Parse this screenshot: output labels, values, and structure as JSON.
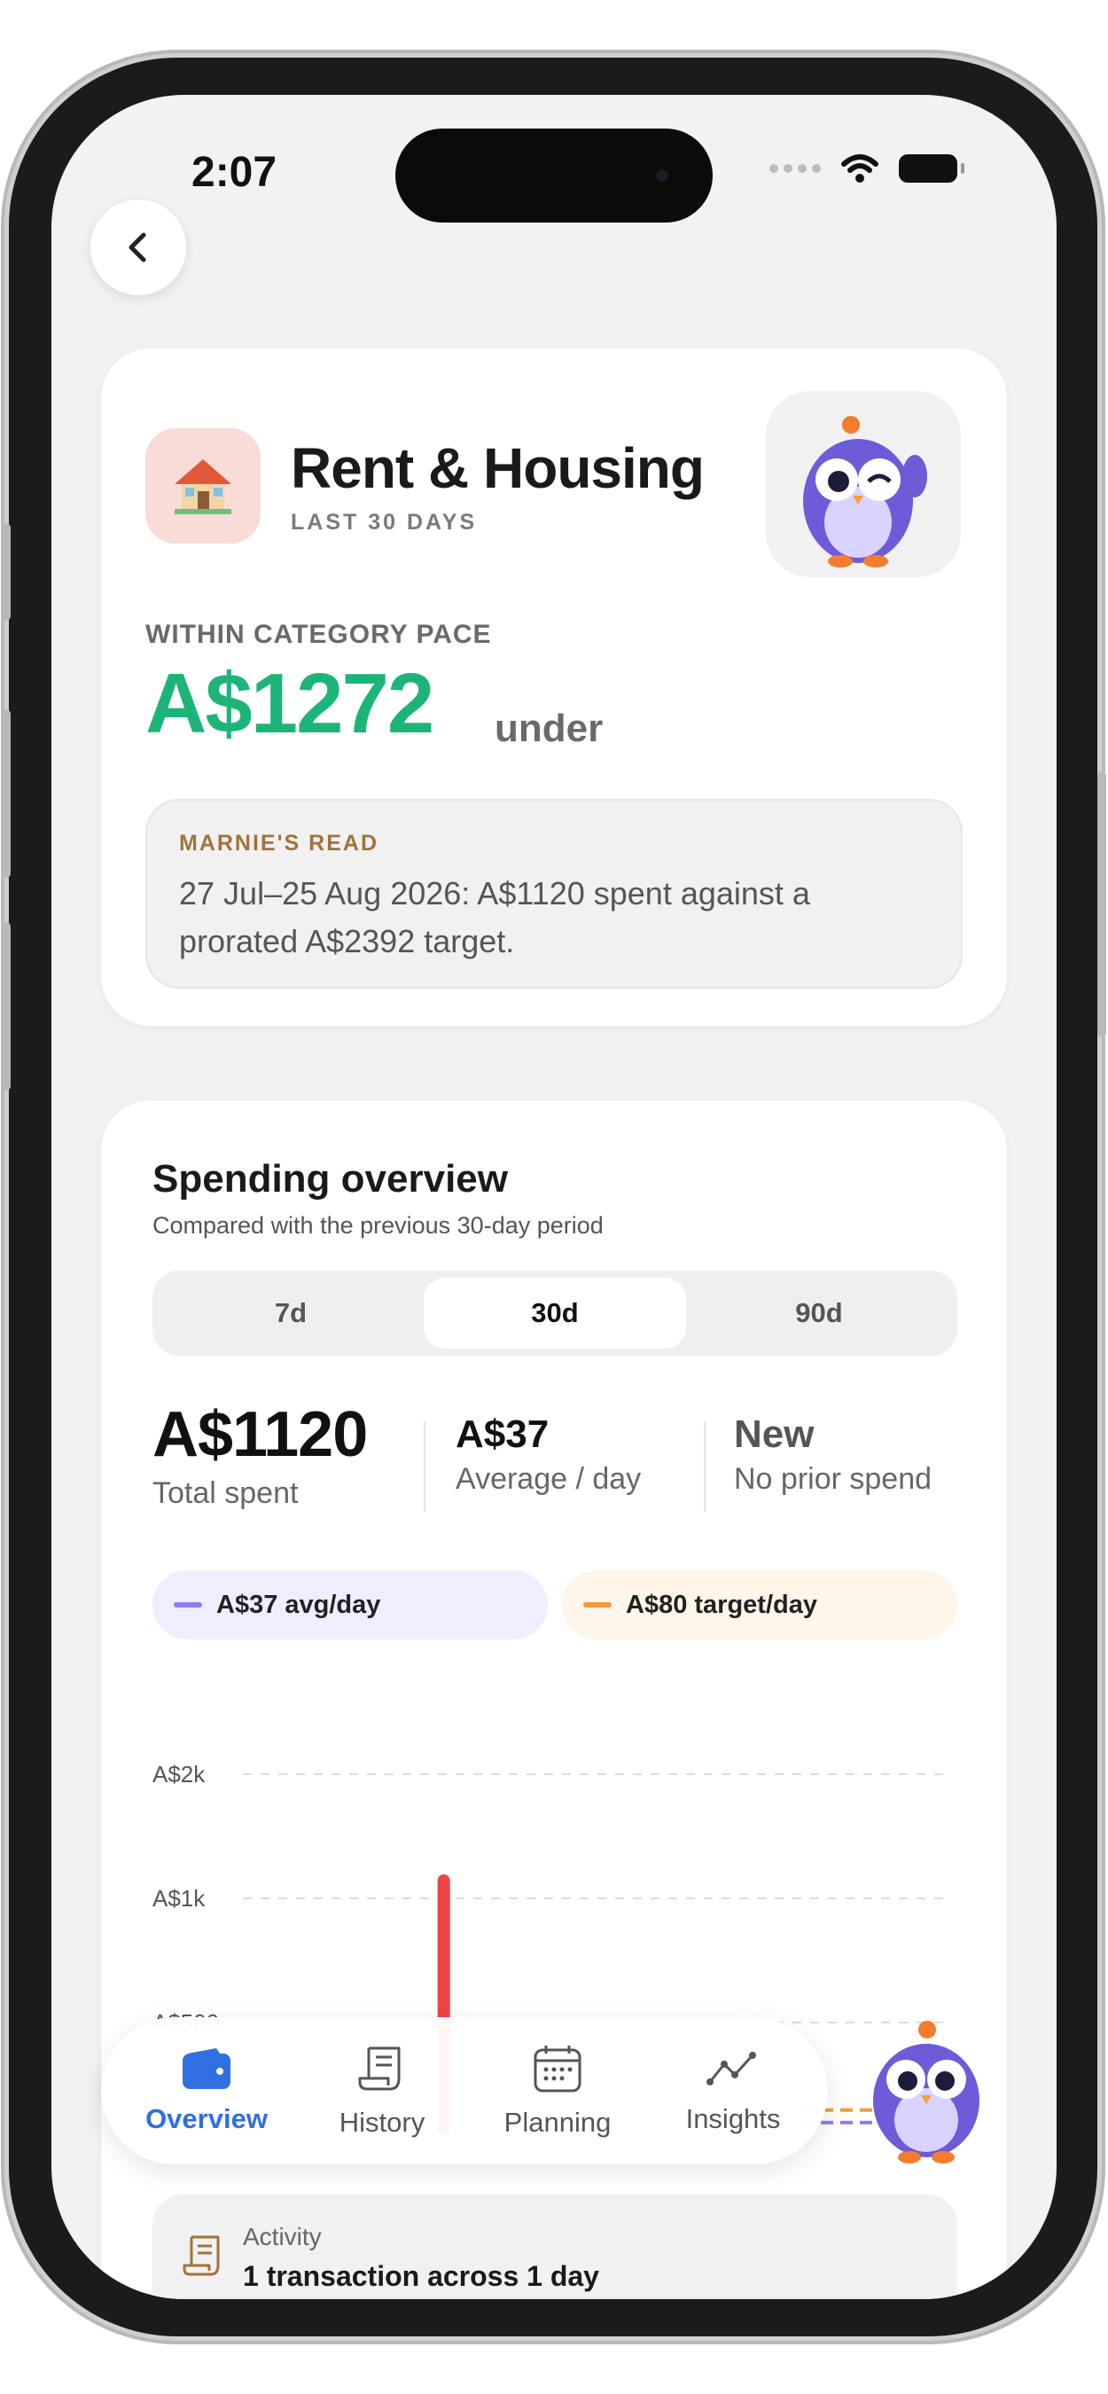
{
  "status_bar": {
    "time": "2:07"
  },
  "category": {
    "title": "Rent & Housing",
    "period": "LAST 30 DAYS",
    "pace_label": "WITHIN CATEGORY PACE",
    "pace_amount": "A$1272",
    "pace_suffix": "under",
    "read_title": "MARNIE'S READ",
    "read_text": "27 Jul–25 Aug 2026: A$1120 spent against a prorated A$2392 target."
  },
  "overview": {
    "title": "Spending overview",
    "subtitle": "Compared with the previous 30-day period",
    "ranges": [
      "7d",
      "30d",
      "90d"
    ],
    "selected_range": "30d",
    "stats": [
      {
        "value": "A$1120",
        "label": "Total spent"
      },
      {
        "value": "A$37",
        "label": "Average / day"
      },
      {
        "value": "New",
        "label": "No prior spend"
      }
    ],
    "legend": [
      {
        "label": "A$37 avg/day",
        "color": "#8b7cf6",
        "bg": "#f0eefe"
      },
      {
        "label": "A$80 target/day",
        "color": "#f59a3a",
        "bg": "#fef6e8"
      }
    ]
  },
  "chart_data": {
    "type": "bar",
    "yticks": [
      "A$2k",
      "A$1k",
      "A$500"
    ],
    "y_tick_values": [
      2000,
      1000,
      500
    ],
    "ylim": [
      0,
      2000
    ],
    "bar_color": "#ef4444",
    "bars": [
      {
        "x": 8,
        "value": 1120
      }
    ],
    "x_count": 30,
    "avg_line": 37,
    "target_line": 80,
    "avg_color": "#8b7cf6",
    "target_color": "#f59a3a",
    "grid": true
  },
  "tabs": [
    {
      "label": "Overview",
      "active": true
    },
    {
      "label": "History",
      "active": false
    },
    {
      "label": "Planning",
      "active": false
    },
    {
      "label": "Insights",
      "active": false
    }
  ],
  "activity": {
    "label": "Activity",
    "value": "1 transaction across 1 day"
  }
}
